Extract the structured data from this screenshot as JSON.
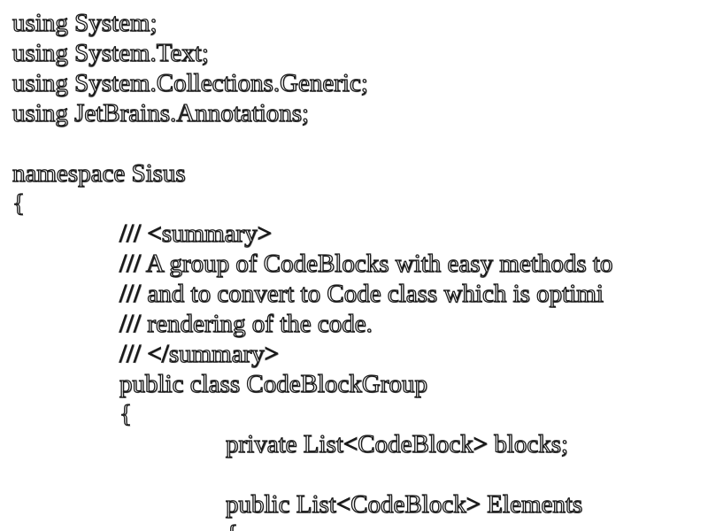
{
  "code": {
    "lines": [
      "using System;",
      "using System.Text;",
      "using System.Collections.Generic;",
      "using JetBrains.Annotations;",
      "",
      "namespace Sisus",
      "{",
      "/// <summary>",
      "/// A group of CodeBlocks with easy methods to",
      "/// and to convert to Code class which is optimi",
      "/// rendering of the code.",
      "/// </summary>",
      "public class CodeBlockGroup",
      "{",
      "private List<CodeBlock> blocks;",
      "",
      "public List<CodeBlock> Elements",
      "{"
    ]
  }
}
